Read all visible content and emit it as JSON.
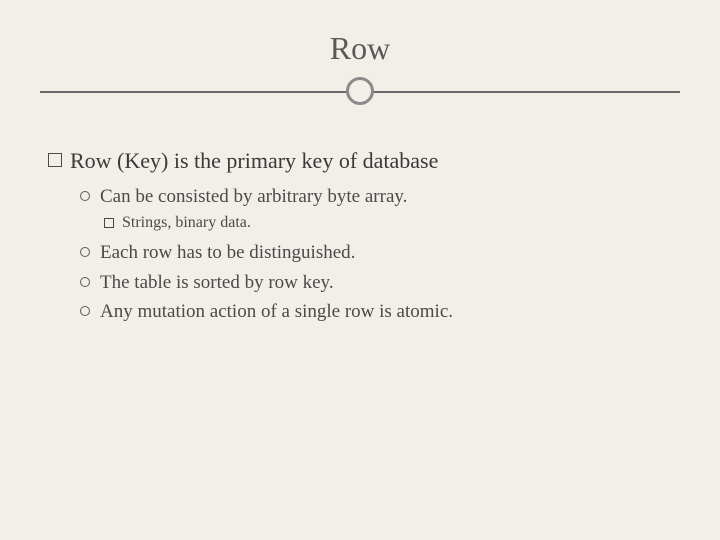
{
  "title": "Row",
  "main_point": "Row (Key) is the primary key of database",
  "sub_points": [
    {
      "text": "Can be consisted by arbitrary byte array.",
      "children": [
        "Strings, binary data."
      ]
    },
    {
      "text": "Each row has to be distinguished."
    },
    {
      "text": "The table is sorted by row key."
    },
    {
      "text": "Any mutation action of a single row is atomic."
    }
  ]
}
